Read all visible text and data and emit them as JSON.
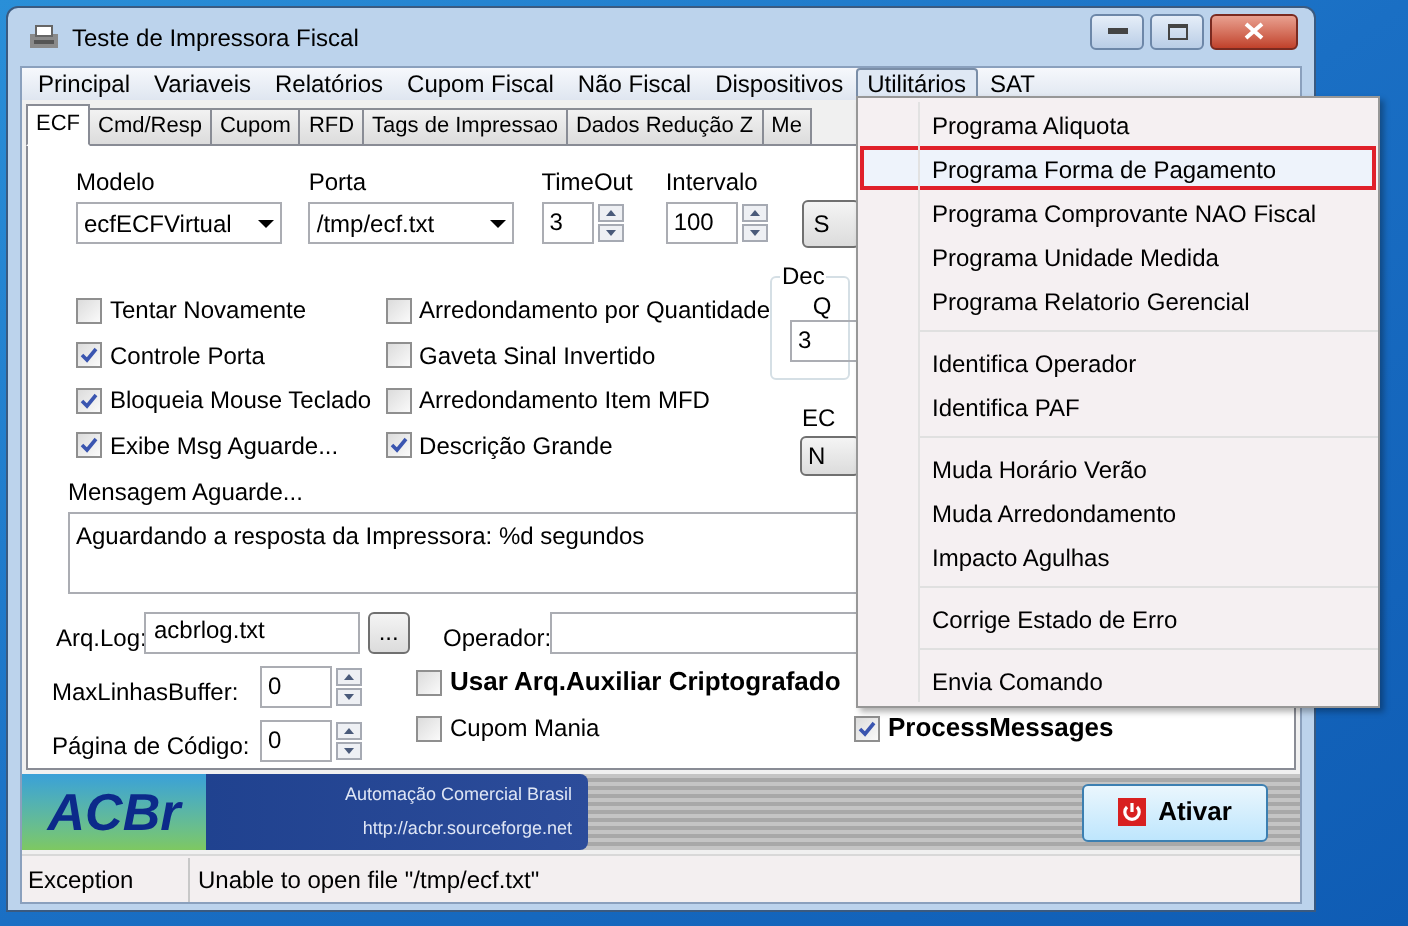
{
  "window": {
    "title": "Teste de Impressora Fiscal"
  },
  "menu_bar": [
    {
      "label": "Principal",
      "selected": false
    },
    {
      "label": "Variaveis",
      "selected": false
    },
    {
      "label": "Relatórios",
      "selected": false
    },
    {
      "label": "Cupom Fiscal",
      "selected": false
    },
    {
      "label": "Não Fiscal",
      "selected": false
    },
    {
      "label": "Dispositivos",
      "selected": false
    },
    {
      "label": "Utilitários",
      "selected": true
    },
    {
      "label": "SAT",
      "selected": false
    }
  ],
  "dropdown": {
    "groups": [
      [
        {
          "label": "Programa Aliquota",
          "selected": false
        },
        {
          "label": "Programa Forma de Pagamento",
          "selected": true
        },
        {
          "label": "Programa Comprovante NAO Fiscal",
          "selected": false
        },
        {
          "label": "Programa Unidade Medida",
          "selected": false
        },
        {
          "label": "Programa Relatorio Gerencial",
          "selected": false
        }
      ],
      [
        {
          "label": "Identifica Operador",
          "selected": false
        },
        {
          "label": "Identifica PAF",
          "selected": false
        }
      ],
      [
        {
          "label": "Muda Horário Verão",
          "selected": false
        },
        {
          "label": "Muda Arredondamento",
          "selected": false
        },
        {
          "label": "Impacto Agulhas",
          "selected": false
        }
      ],
      [
        {
          "label": "Corrige Estado de Erro",
          "selected": false
        }
      ],
      [
        {
          "label": "Envia Comando",
          "selected": false
        }
      ]
    ]
  },
  "tabs": [
    {
      "label": "ECF",
      "selected": true
    },
    {
      "label": "Cmd/Resp",
      "selected": false
    },
    {
      "label": "Cupom",
      "selected": false
    },
    {
      "label": "RFD",
      "selected": false
    },
    {
      "label": "Tags de Impressao",
      "selected": false
    },
    {
      "label": "Dados Redução Z",
      "selected": false
    },
    {
      "label": "Me",
      "selected": false
    }
  ],
  "ecf": {
    "modelo": {
      "label": "Modelo",
      "value": "ecfECFVirtual"
    },
    "porta": {
      "label": "Porta",
      "value": "/tmp/ecf.txt"
    },
    "timeout": {
      "label": "TimeOut",
      "value": "3"
    },
    "intervalo": {
      "label": "Intervalo",
      "value": "100"
    },
    "partial_button": "S",
    "options_left": [
      {
        "label": "Tentar Novamente",
        "checked": false
      },
      {
        "label": "Controle Porta",
        "checked": true
      },
      {
        "label": "Bloqueia Mouse Teclado",
        "checked": true
      },
      {
        "label": "Exibe Msg Aguarde...",
        "checked": true
      }
    ],
    "options_right": [
      {
        "label": "Arredondamento por Quantidade",
        "checked": false
      },
      {
        "label": "Gaveta Sinal Invertido",
        "checked": false
      },
      {
        "label": "Arredondamento Item MFD",
        "checked": false
      },
      {
        "label": "Descrição Grande",
        "checked": true
      }
    ],
    "decimals_group": {
      "title": "Dec",
      "label": "Q",
      "value": "3"
    },
    "ec_label": "EC",
    "ec_button": "N",
    "mensagem_label": "Mensagem Aguarde...",
    "mensagem_value": "Aguardando a resposta da Impressora: %d segundos",
    "arq_log": {
      "label": "Arq.Log:",
      "value": "acbrlog.txt",
      "button": "..."
    },
    "operador": {
      "label": "Operador:"
    },
    "max_linhas": {
      "label": "MaxLinhasBuffer:",
      "value": "0"
    },
    "pagina_codigo": {
      "label": "Página de Código:",
      "value": "0"
    },
    "usar_arq": {
      "label": "Usar Arq.Auxiliar Criptografado",
      "checked": false
    },
    "cupom_mania": {
      "label": "Cupom Mania",
      "checked": false
    },
    "process_messages": {
      "label": "ProcessMessages",
      "checked": true
    }
  },
  "banner": {
    "logo": "ACBr",
    "tagline": "Automação Comercial Brasil",
    "url": "http://acbr.sourceforge.net",
    "button": "Ativar"
  },
  "status_bar": [
    "Exception",
    "Unable to open file \"/tmp/ecf.txt\""
  ]
}
